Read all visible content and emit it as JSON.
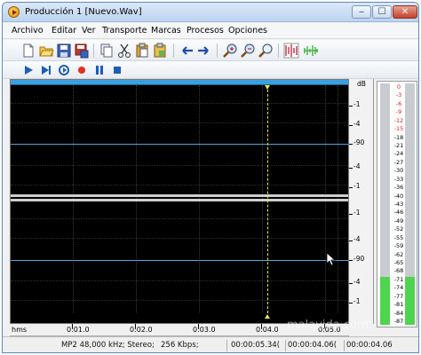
{
  "window": {
    "title": "Producción 1 [Nuevo.Wav]",
    "controls": {
      "minimize": "‒",
      "maximize": "☐",
      "close": "✕"
    }
  },
  "menubar": {
    "items": [
      "Archivo",
      "Editar",
      "Ver",
      "Transporte",
      "Marcas",
      "Procesos",
      "Opciones"
    ]
  },
  "toolbar1": {
    "buttons": [
      {
        "icon": "new-file-icon"
      },
      {
        "icon": "open-folder-icon"
      },
      {
        "icon": "save-icon"
      },
      {
        "icon": "save-as-icon"
      },
      {
        "icon": "copy-icon"
      },
      {
        "icon": "cut-icon"
      },
      {
        "icon": "paste-icon"
      },
      {
        "icon": "paste-mix-icon"
      },
      {
        "icon": "undo-arrow-icon"
      },
      {
        "icon": "redo-arrow-icon"
      },
      {
        "icon": "zoom-in-icon"
      },
      {
        "icon": "zoom-out-icon"
      },
      {
        "icon": "zoom-selection-icon"
      },
      {
        "icon": "waveform-view-icon"
      },
      {
        "icon": "spectrum-view-icon"
      }
    ]
  },
  "toolbar2": {
    "buttons": [
      {
        "icon": "play-icon"
      },
      {
        "icon": "play-to-end-icon"
      },
      {
        "icon": "loop-icon"
      },
      {
        "icon": "record-icon"
      },
      {
        "icon": "pause-icon"
      },
      {
        "icon": "stop-icon"
      }
    ]
  },
  "db_scale": {
    "header": "dB",
    "labels": [
      "-1",
      "-4",
      "-90",
      "-4",
      "-1",
      "-1",
      "-4",
      "-90",
      "-4",
      "-1"
    ]
  },
  "meter": {
    "labels": [
      "0",
      "-3",
      "-6",
      "-9",
      "-12",
      "-15",
      "-18",
      "-21",
      "-24",
      "-27",
      "-30",
      "-33",
      "-36",
      "-40",
      "-43",
      "-46",
      "-49",
      "-52",
      "-55",
      "-59",
      "-62",
      "-65",
      "-68",
      "-71",
      "-74",
      "-77",
      "-81",
      "-84",
      "-87"
    ],
    "red_count": 6,
    "left_level": 0.2,
    "right_level": 0.2
  },
  "ruler": {
    "unit": "hms",
    "labels": [
      "0:01.0",
      "0:02.0",
      "0:03.0",
      "0:04.0",
      "0:05.0"
    ]
  },
  "status": {
    "format": "MP2 48,000 kHz; Stereo;",
    "bitrate": "256 Kbps;",
    "time_start": "00:00:05.34(",
    "time_end": "00:00:04.06(",
    "time_length": "00:00:04.06"
  },
  "watermark": "malavida.com"
}
